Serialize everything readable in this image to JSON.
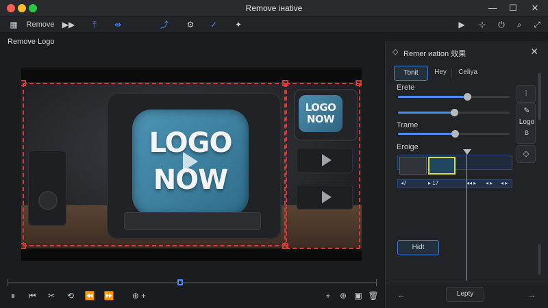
{
  "window": {
    "title": "Remove iнative"
  },
  "toolbar": {
    "remove_label": "Remove",
    "icons": [
      "sidebar-icon",
      "play-forward-icon",
      "export-icon",
      "split-icon",
      "upload-icon",
      "settings-icon",
      "check-icon",
      "pin-icon",
      "play-icon",
      "trim-icon",
      "power-icon",
      "search-icon",
      "expand-icon"
    ]
  },
  "workspace": {
    "title": "Remove Logo",
    "preview": {
      "logo_line1": "LOGO",
      "logo_line2": "NOW",
      "mini_line1": "LOGO",
      "mini_line2": "NOW"
    }
  },
  "panel": {
    "title": "Remer иation 效果",
    "tabs": [
      {
        "label": "Tonit",
        "active": true
      },
      {
        "label": "Hey",
        "active": false
      },
      {
        "label": "Celiya",
        "active": false
      }
    ],
    "fields": [
      {
        "label": "Erete",
        "value": 0.62
      },
      {
        "label": "",
        "value": 0.5
      },
      {
        "label": "Trame",
        "value": 0.51
      },
      {
        "label": "Eroige",
        "value": 0.63
      }
    ],
    "side_tool": {
      "label_top": "Logo",
      "label_bottom": "B"
    },
    "timeline_labels": [
      "◂7",
      "▸ 17",
      "◂◂ ▸",
      "◂ ▸",
      "◂ ▸"
    ],
    "hide_button": "Hidt",
    "footer_label": "Lepty"
  }
}
